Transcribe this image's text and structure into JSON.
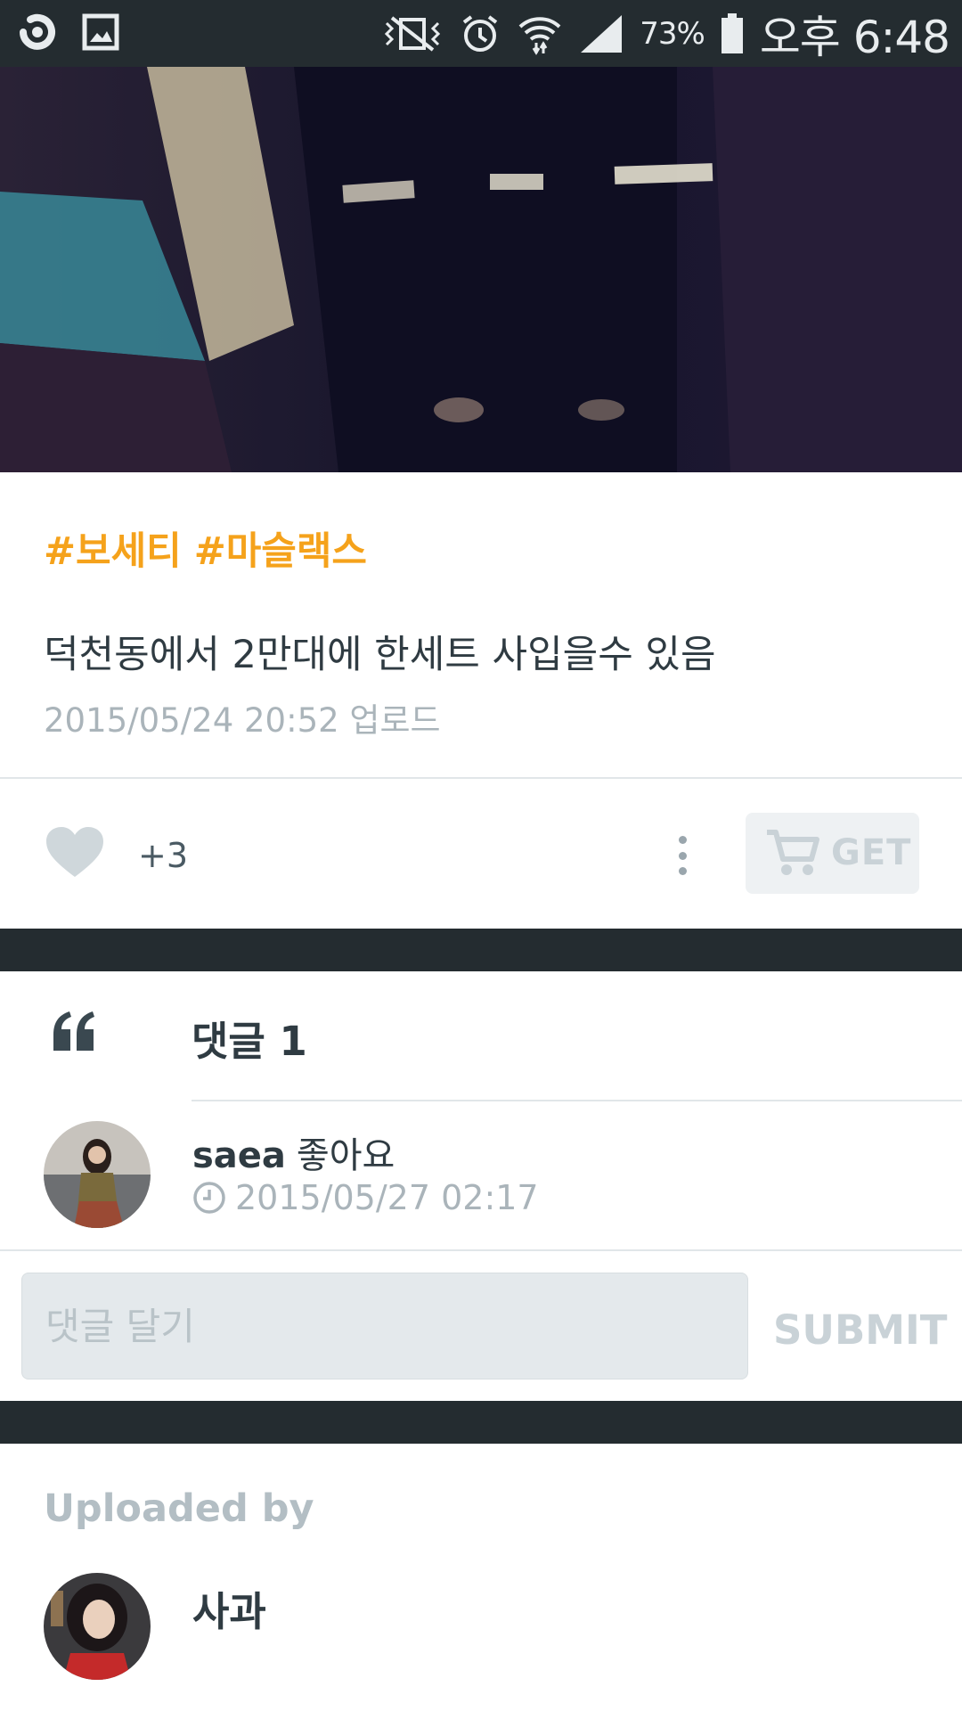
{
  "status_bar": {
    "battery_percent": "73%",
    "time": "오후 6:48",
    "icons": [
      "app-logo-icon",
      "gallery-icon",
      "vibrate-icon",
      "alarm-icon",
      "wifi-icon",
      "signal-icon",
      "battery-icon"
    ]
  },
  "post": {
    "tags": [
      "#보세티",
      "#마슬랙스"
    ],
    "description": "덕천동에서 2만대에 한세트 사입을수 있음",
    "upload_date": "2015/05/24 20:52 업로드",
    "like_count": "+3",
    "get_label": "GET"
  },
  "comments": {
    "title": "댓글 1",
    "items": [
      {
        "user": "saea",
        "text": "좋아요",
        "time": "2015/05/27 02:17"
      }
    ],
    "input_placeholder": "댓글 달기",
    "submit_label": "SUBMIT"
  },
  "uploader": {
    "label": "Uploaded by",
    "name": "사과"
  },
  "colors": {
    "dark_band": "#242c30",
    "tag_orange": "#f5a21b",
    "text_dark": "#2f3b42",
    "text_muted": "#aab4ba"
  }
}
